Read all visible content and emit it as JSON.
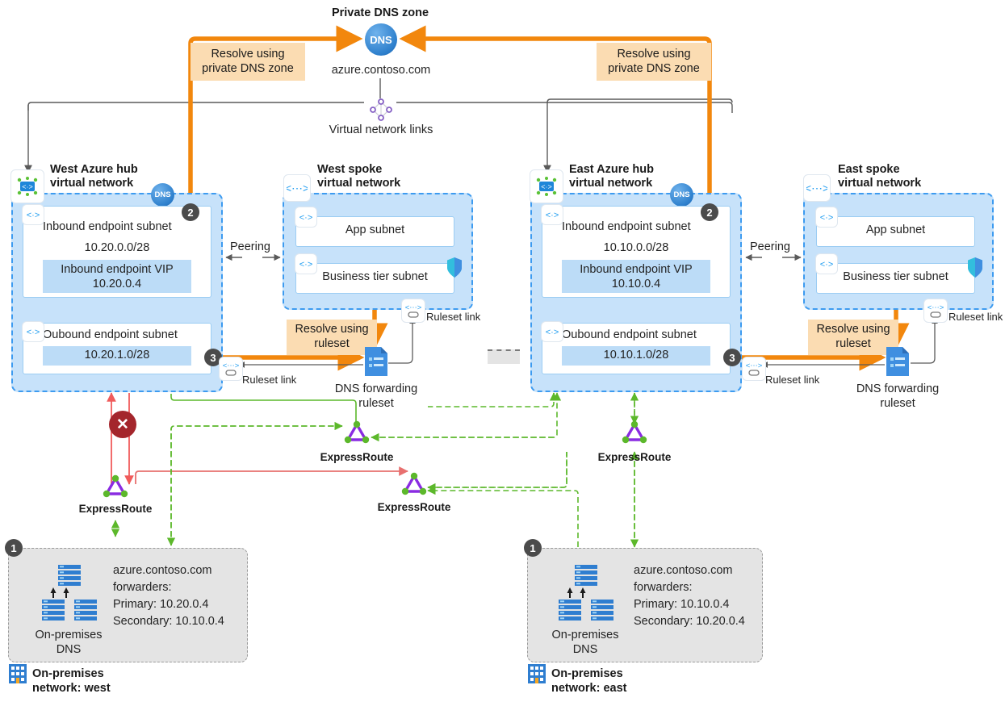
{
  "diagram": {
    "title": "Private DNS zone",
    "zone_name": "azure.contoso.com",
    "vnet_links_label": "Virtual network links",
    "dns_icon_label": "DNS",
    "colors": {
      "orange": "#f2870d",
      "orange_band": "#fbdcb2",
      "vnet_fill": "#c7e2fa",
      "vnet_border": "#3d9bf0",
      "subnet_fill": "#ffffff",
      "ip_band": "#bcdcf7",
      "gray_zone": "#e4e4e4",
      "green": "#5cb82b",
      "red": "#e8706f",
      "error_red": "#a4262c",
      "purple": "#8a2be2",
      "badge_gray": "#4b4b4b",
      "azure_blue": "#2d7fcc"
    },
    "callouts": {
      "private_dns_zone": "Resolve using\nprivate DNS zone",
      "private_dns_zone_line1": "Resolve using",
      "private_dns_zone_line2": "private DNS zone",
      "ruleset_line1": "Resolve using",
      "ruleset_line2": "ruleset"
    },
    "badges": {
      "one": "1",
      "two": "2",
      "three": "3"
    },
    "peering_label": "Peering",
    "ruleset_link_label": "Ruleset link",
    "forwarding_ruleset_line1": "DNS forwarding",
    "forwarding_ruleset_line2": "ruleset",
    "expressroute_label": "ExpressRoute"
  },
  "hubs": [
    {
      "id": "west-hub",
      "title_line1": "West Azure hub",
      "title_line2": "virtual network",
      "inbound_subnet_label": "Inbound endpoint subnet",
      "inbound_cidr": "10.20.0.0/28",
      "vip_label": "Inbound endpoint VIP",
      "vip_ip": "10.20.0.4",
      "outbound_subnet_label": "Oubound endpoint subnet",
      "outbound_cidr": "10.20.1.0/28"
    },
    {
      "id": "east-hub",
      "title_line1": "East Azure hub",
      "title_line2": "virtual network",
      "inbound_subnet_label": "Inbound endpoint subnet",
      "inbound_cidr": "10.10.0.0/28",
      "vip_label": "Inbound endpoint VIP",
      "vip_ip": "10.10.0.4",
      "outbound_subnet_label": "Oubound endpoint subnet",
      "outbound_cidr": "10.10.1.0/28"
    }
  ],
  "spokes": [
    {
      "id": "west-spoke",
      "title_line1": "West spoke",
      "title_line2": "virtual network",
      "app_subnet": "App subnet",
      "business_subnet": "Business tier subnet"
    },
    {
      "id": "east-spoke",
      "title_line1": "East spoke",
      "title_line2": "virtual network",
      "app_subnet": "App subnet",
      "business_subnet": "Business tier subnet"
    }
  ],
  "onprem": [
    {
      "id": "onprem-west",
      "dns_label_line1": "On-premises",
      "dns_label_line2": "DNS",
      "forwarders_line1": "azure.contoso.com",
      "forwarders_line2": "forwarders:",
      "forwarders_line3": "Primary: 10.20.0.4",
      "forwarders_line4": "Secondary: 10.10.0.4",
      "network_line1": "On-premises",
      "network_line2": "network: west"
    },
    {
      "id": "onprem-east",
      "dns_label_line1": "On-premises",
      "dns_label_line2": "DNS",
      "forwarders_line1": "azure.contoso.com",
      "forwarders_line2": "forwarders:",
      "forwarders_line3": "Primary: 10.10.0.4",
      "forwarders_line4": "Secondary: 10.20.0.4",
      "network_line1": "On-premises",
      "network_line2": "network: east"
    }
  ],
  "expressroutes": [
    {
      "id": "er-west-hub",
      "label": "ExpressRoute"
    },
    {
      "id": "er-west-onprem",
      "label": "ExpressRoute"
    },
    {
      "id": "er-east-hub",
      "label": "ExpressRoute"
    },
    {
      "id": "er-east-onprem",
      "label": "ExpressRoute"
    }
  ],
  "links": [
    {
      "id": "west-ruleset-link-hub",
      "label": "Ruleset link"
    },
    {
      "id": "west-ruleset-link-spoke",
      "label": "Ruleset link"
    },
    {
      "id": "east-ruleset-link-hub",
      "label": "Ruleset link"
    },
    {
      "id": "east-ruleset-link-spoke",
      "label": "Ruleset link"
    }
  ]
}
